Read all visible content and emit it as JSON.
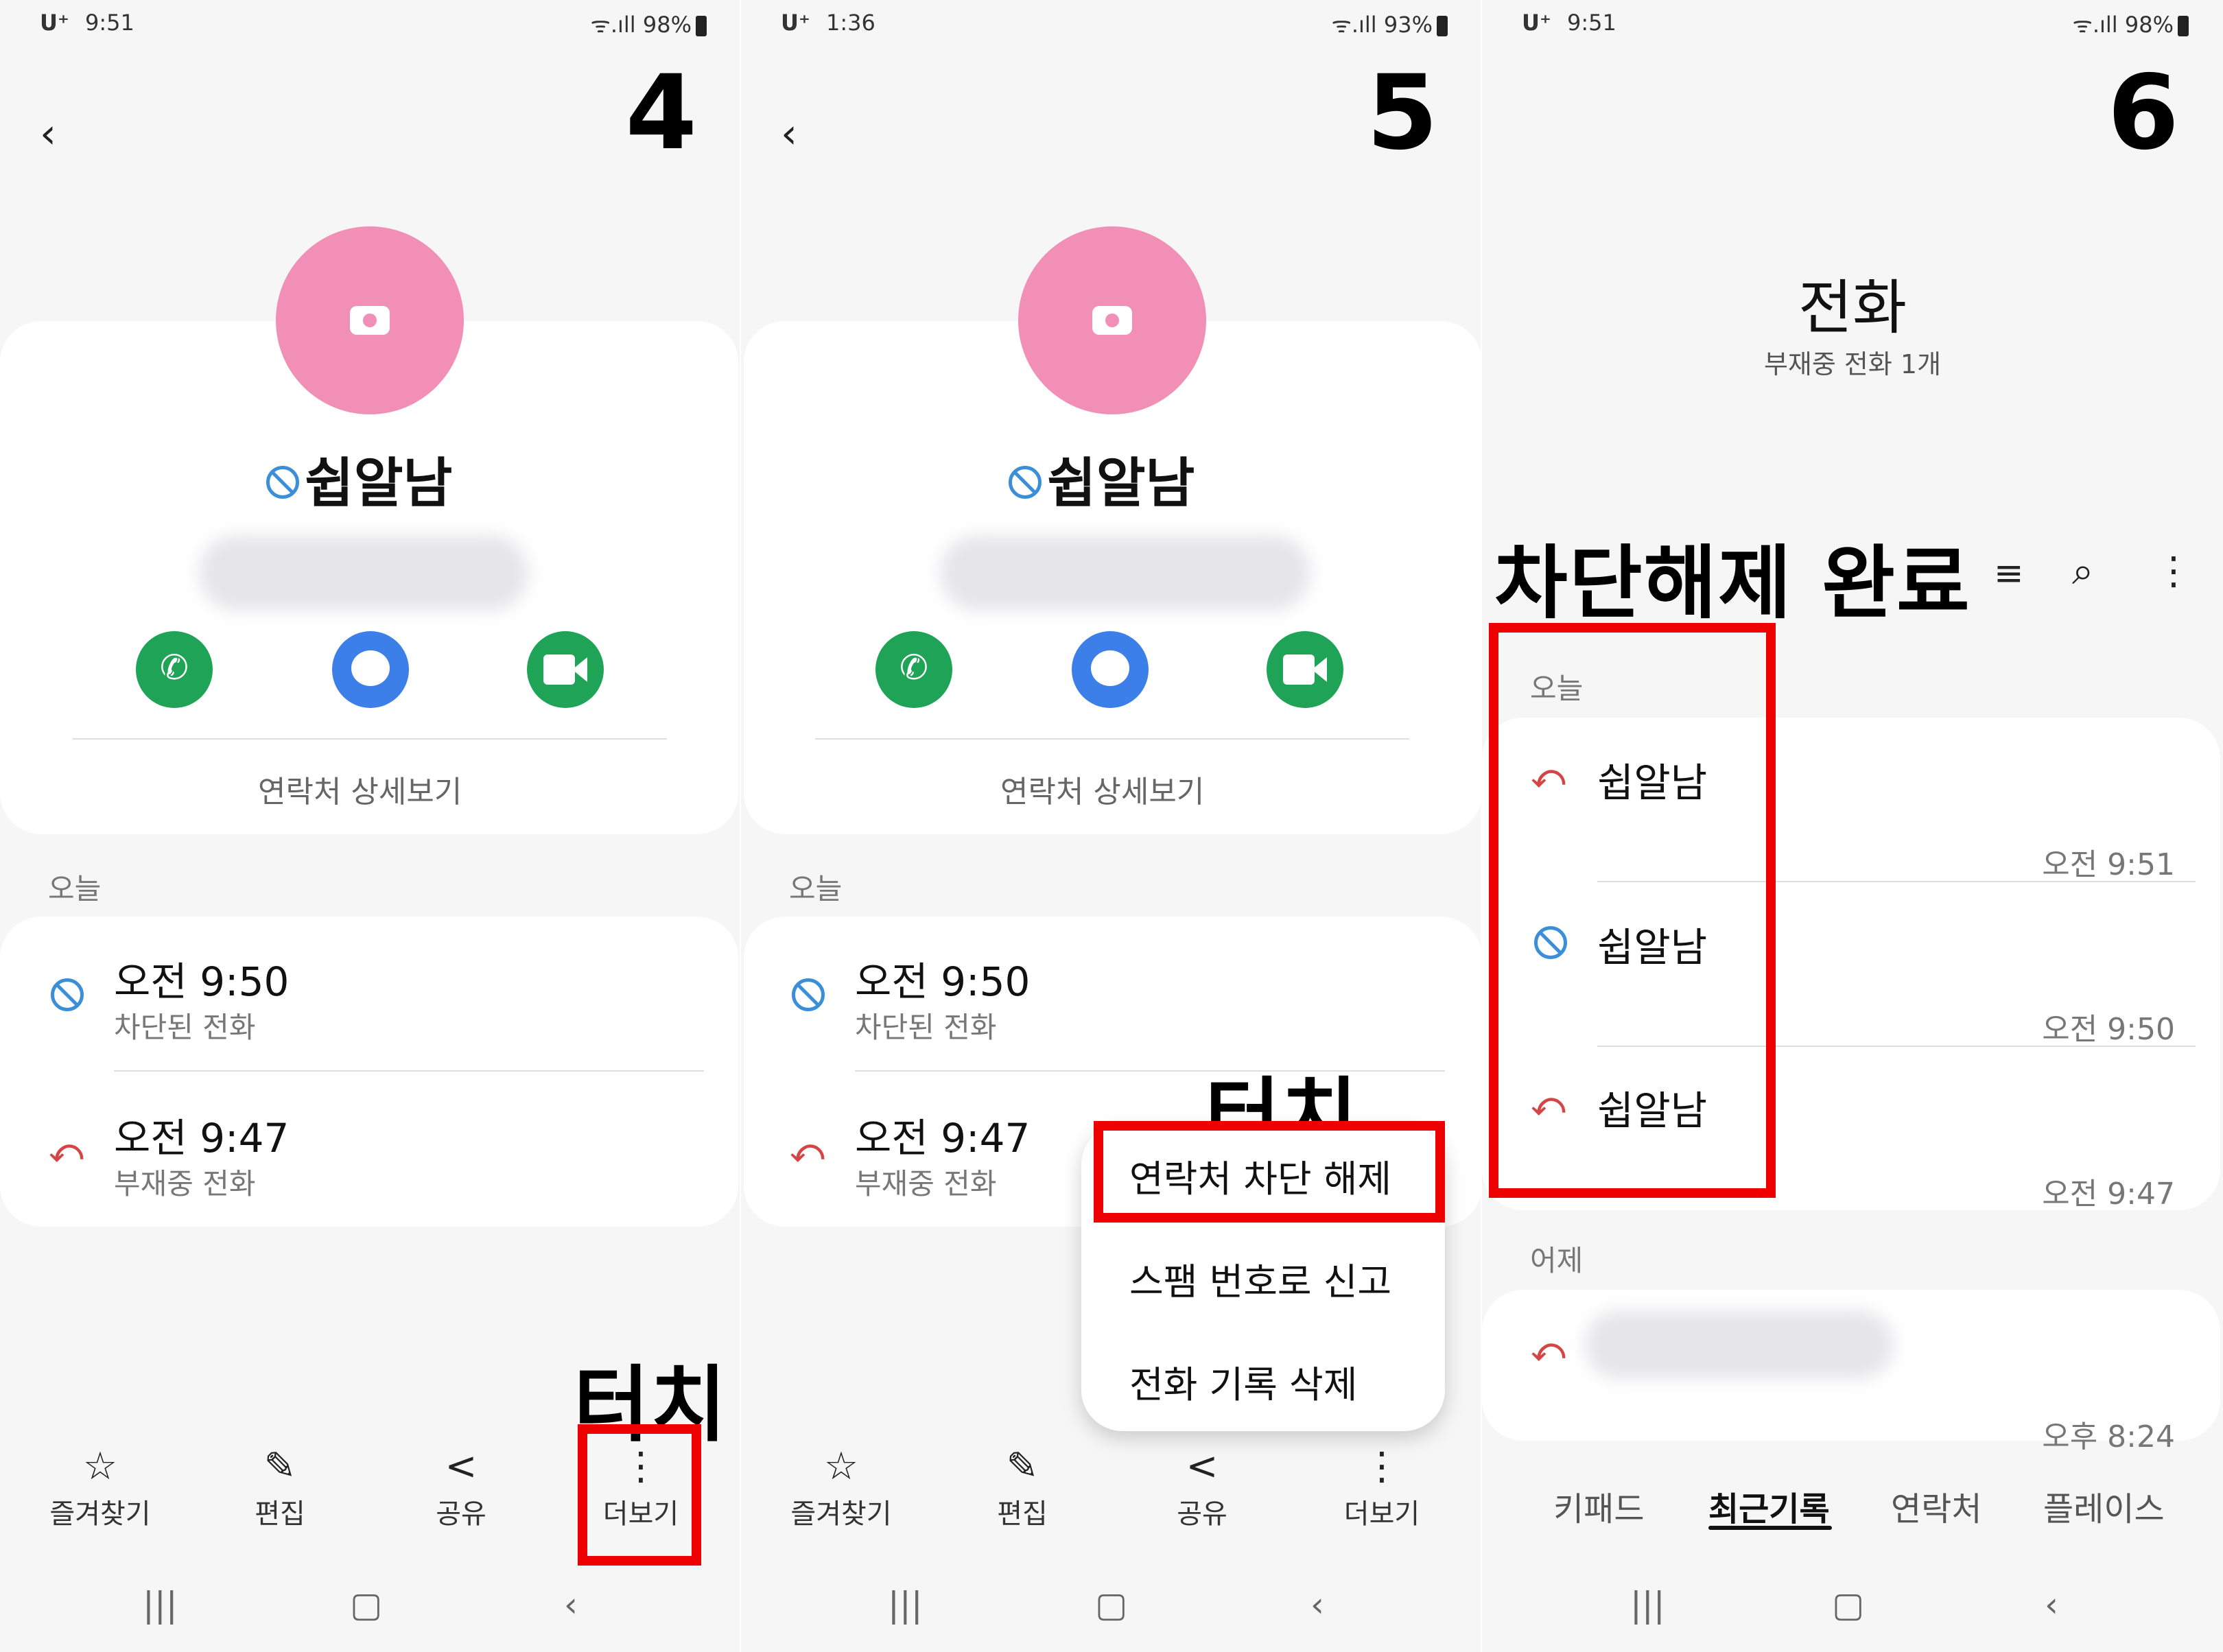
{
  "panels": [
    {
      "status": {
        "carrier": "U⁺",
        "time": "9:51",
        "indicators": "ᯤ.ıll 98%"
      },
      "step": "4",
      "contact": {
        "name": "쉽알남",
        "details_link": "연락처 상세보기"
      },
      "section_today": "오늘",
      "logs": [
        {
          "time": "오전 9:50",
          "type": "차단된 전화"
        },
        {
          "time": "오전 9:47",
          "type": "부재중 전화"
        }
      ],
      "bottom": [
        {
          "icon": "☆",
          "label": "즐겨찾기"
        },
        {
          "icon": "✎",
          "label": "편집"
        },
        {
          "icon": "<",
          "label": "공유"
        },
        {
          "icon": "⋮",
          "label": "더보기"
        }
      ],
      "annotation": "터치"
    },
    {
      "status": {
        "carrier": "U⁺",
        "time": "1:36",
        "indicators": "ᯤ.ıll 93%"
      },
      "step": "5",
      "contact": {
        "name": "쉽알남",
        "details_link": "연락처 상세보기"
      },
      "section_today": "오늘",
      "logs": [
        {
          "time": "오전 9:50",
          "type": "차단된 전화"
        },
        {
          "time": "오전 9:47",
          "type": "부재중 전화"
        }
      ],
      "bottom": [
        {
          "icon": "☆",
          "label": "즐겨찾기"
        },
        {
          "icon": "✎",
          "label": "편집"
        },
        {
          "icon": "<",
          "label": "공유"
        },
        {
          "icon": "⋮",
          "label": "더보기"
        }
      ],
      "menu": [
        "연락처 차단 해제",
        "스팸 번호로 신고",
        "전화 기록 삭제"
      ],
      "annotation": "터치"
    },
    {
      "status": {
        "carrier": "U⁺",
        "time": "9:51",
        "indicators": "ᯤ.ıll 98%"
      },
      "step": "6",
      "title": "전화",
      "subtitle": "부재중 전화 1개",
      "annotation": "차단해제 완료",
      "section_today": "오늘",
      "section_yesterday": "어제",
      "recents": [
        {
          "name": "쉽알남",
          "time": "오전 9:51",
          "kind": "missed"
        },
        {
          "name": "쉽알남",
          "time": "오전 9:50",
          "kind": "blocked"
        },
        {
          "name": "쉽알남",
          "time": "오전 9:47",
          "kind": "missed"
        }
      ],
      "yesterday_time": "오후 8:24",
      "tabs": [
        "키패드",
        "최근기록",
        "연락처",
        "플레이스"
      ]
    }
  ]
}
